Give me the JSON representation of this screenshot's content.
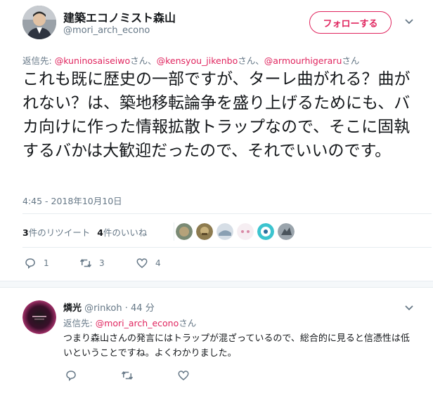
{
  "tweet": {
    "display_name": "建築エコノミスト森山",
    "handle": "@mori_arch_econo",
    "follow_label": "フォローする",
    "reply_to_label": "返信先: ",
    "mentions": [
      {
        "name": "@kuninosaiseiwo",
        "suffix": "さん、"
      },
      {
        "name": "@kensyou_jikenbo",
        "suffix": "さん、"
      },
      {
        "name": "@armourhigeraru",
        "suffix": "さん"
      }
    ],
    "text": "これも既に歴史の一部ですが、ターレ曲がれる？曲がれない？は、築地移転論争を盛り上げるためにも、バカ向けに作った情報拡散トラップなので、そこに固執するバかは大歓迎だったので、それでいいのです。",
    "timestamp": "4:45 - 2018年10月10日",
    "retweets_count": "3",
    "retweets_label": "件のリツイート",
    "likes_count": "4",
    "likes_label": "件のいいね",
    "actions": {
      "reply_count": "1",
      "retweet_count": "3",
      "like_count": "4"
    },
    "colors": {
      "accent": "#e0245e",
      "muted": "#657786",
      "text": "#14171a",
      "divider": "#e6ecf0"
    },
    "likers": [
      "#7a8a74",
      "#8d7b4f",
      "#a9b8c6",
      "#f0e3ec",
      "#3cc4cf",
      "#5a6670"
    ]
  },
  "reply": {
    "display_name": "燐光",
    "handle": "@rinkoh",
    "time": "· 44 分",
    "reply_to_label": "返信先: ",
    "mention": "@mori_arch_econo",
    "mention_suffix": "さん",
    "text": "つまり森山さんの発言にはトラップが混ざっているので、総合的に見ると信憑性は低いということですね。よくわかりました。"
  }
}
